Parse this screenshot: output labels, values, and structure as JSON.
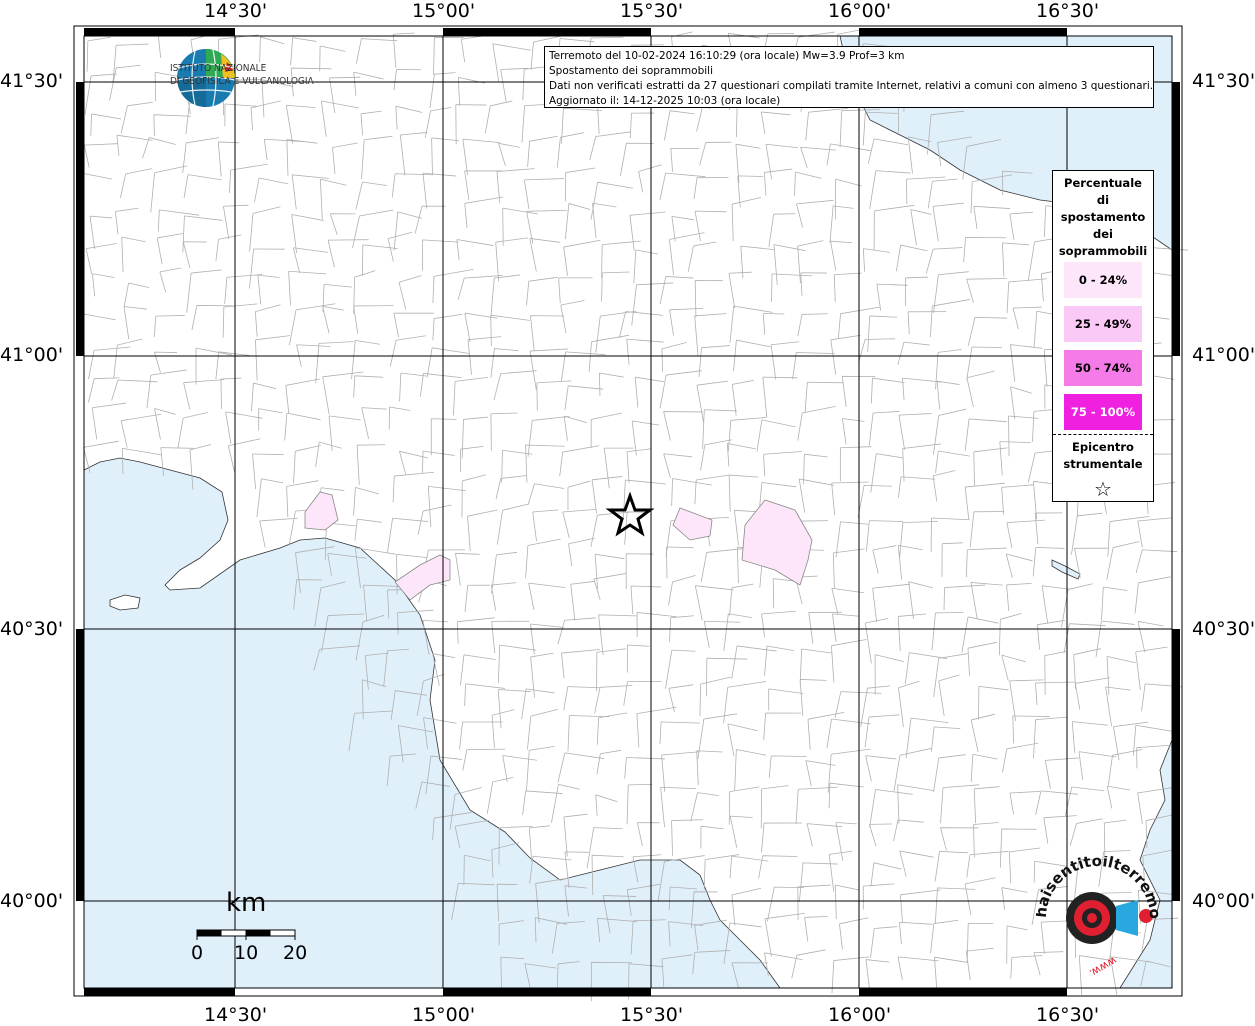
{
  "header": {
    "line1": "Terremoto del 10-02-2024 16:10:29 (ora locale) Mw=3.9 Prof=3 km",
    "line2": "Spostamento dei soprammobili",
    "line3": "Dati non verificati estratti da 27 questionari compilati tramite Internet, relativi a comuni con almeno 3 questionari.",
    "line4": "Aggiornato il: 14-12-2025 10:03 (ora locale)"
  },
  "axes": {
    "top_labels": [
      "14°30'",
      "15°00'",
      "15°30'",
      "16°00'",
      "16°30'"
    ],
    "bottom_labels": [
      "14°30'",
      "15°00'",
      "15°30'",
      "16°00'",
      "16°30'"
    ],
    "left_labels": [
      "41°30'",
      "41°00'",
      "40°30'",
      "40°00'"
    ],
    "right_labels": [
      "41°30'",
      "41°00'",
      "40°30'",
      "40°00'"
    ]
  },
  "logo": {
    "line1": "ISTITUTO NAZIONALE",
    "line2": "DI GEOFISICA E VULCANOLOGIA"
  },
  "legend": {
    "title": [
      "Percentuale",
      "di",
      "spostamento",
      "dei",
      "soprammobili"
    ],
    "classes": [
      {
        "label": "0 - 24%",
        "color": "#fde6fa"
      },
      {
        "label": "25 - 49%",
        "color": "#fbc9f5"
      },
      {
        "label": "50 - 74%",
        "color": "#f57ce8"
      },
      {
        "label": "75 - 100%",
        "color": "#f020e0"
      }
    ],
    "epicenter_title": [
      "Epicentro",
      "strumentale"
    ]
  },
  "scale": {
    "title": "km",
    "labels": [
      "0",
      "10",
      "20"
    ]
  },
  "colors": {
    "sea": "#e0f0fb",
    "land": "#ffffff",
    "border": "#aaaaaa",
    "grid": "#000000"
  },
  "hsit_logo": {
    "text": "haisentitoilterremoto.it",
    "alt": "www."
  }
}
